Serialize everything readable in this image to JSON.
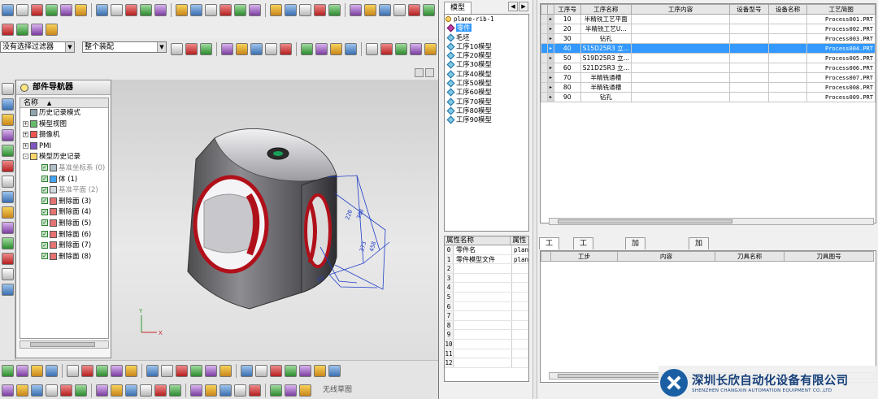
{
  "cad": {
    "filter_left": "没有选择过滤器",
    "filter_right": "整个装配",
    "nav_title": "部件导航器",
    "nav_header": "名称",
    "nav_nodes": [
      {
        "label": "历史记录模式",
        "icon": "history-icon",
        "expand": ""
      },
      {
        "label": "模型视图",
        "icon": "model-view-icon",
        "expand": "+"
      },
      {
        "label": "摄像机",
        "icon": "camera-icon",
        "expand": "+"
      },
      {
        "label": "PMI",
        "icon": "pmi-icon",
        "expand": "+"
      },
      {
        "label": "模型历史记录",
        "icon": "folder-icon",
        "expand": "-"
      },
      {
        "label": "基准坐标系 (0)",
        "icon": "datum-csys-icon",
        "expand": "",
        "dim": true
      },
      {
        "label": "体 (1)",
        "icon": "body-icon",
        "expand": ""
      },
      {
        "label": "基准平面 (2)",
        "icon": "datum-plane-icon",
        "expand": "",
        "dim": true
      },
      {
        "label": "删除面 (3)",
        "icon": "delete-face-icon",
        "expand": ""
      },
      {
        "label": "删除面 (4)",
        "icon": "delete-face-icon",
        "expand": ""
      },
      {
        "label": "删除面 (5)",
        "icon": "delete-face-icon",
        "expand": ""
      },
      {
        "label": "删除面 (6)",
        "icon": "delete-face-icon",
        "expand": ""
      },
      {
        "label": "删除面 (7)",
        "icon": "delete-face-icon",
        "expand": ""
      },
      {
        "label": "删除面 (8)",
        "icon": "delete-face-icon",
        "expand": ""
      }
    ],
    "dims": [
      "220",
      "308",
      "373",
      "458",
      "53"
    ],
    "axis_x": "X",
    "axis_y": "Y",
    "bottom_button": "无线草图"
  },
  "app": {
    "tab_model": "模型",
    "tree_root": "plane-rib-1",
    "tree_nodes": [
      {
        "label": "零件",
        "selected": true
      },
      {
        "label": "毛坯",
        "selected": false
      },
      {
        "label": "工序10模型",
        "selected": false
      },
      {
        "label": "工序20模型",
        "selected": false
      },
      {
        "label": "工序30模型",
        "selected": false
      },
      {
        "label": "工序40模型",
        "selected": false
      },
      {
        "label": "工序50模型",
        "selected": false
      },
      {
        "label": "工序60模型",
        "selected": false
      },
      {
        "label": "工序70模型",
        "selected": false
      },
      {
        "label": "工序80模型",
        "selected": false
      },
      {
        "label": "工序90模型",
        "selected": false
      }
    ],
    "props_headers": [
      "属性名称",
      "属性"
    ],
    "props_rows": [
      {
        "idx": "0",
        "name": "零件名",
        "val": "plan"
      },
      {
        "idx": "1",
        "name": "零件模型文件",
        "val": "plan"
      },
      {
        "idx": "2",
        "name": "",
        "val": ""
      },
      {
        "idx": "3",
        "name": "",
        "val": ""
      },
      {
        "idx": "4",
        "name": "",
        "val": ""
      },
      {
        "idx": "5",
        "name": "",
        "val": ""
      },
      {
        "idx": "6",
        "name": "",
        "val": ""
      },
      {
        "idx": "7",
        "name": "",
        "val": ""
      },
      {
        "idx": "8",
        "name": "",
        "val": ""
      },
      {
        "idx": "9",
        "name": "",
        "val": ""
      },
      {
        "idx": "10",
        "name": "",
        "val": ""
      },
      {
        "idx": "11",
        "name": "",
        "val": ""
      },
      {
        "idx": "12",
        "name": "",
        "val": ""
      }
    ],
    "grid_headers": [
      "工序号",
      "工序名称",
      "工序内容",
      "设备型号",
      "设备名称",
      "工艺简图"
    ],
    "grid_rows": [
      {
        "no": "10",
        "name": "半精铣工艺平面",
        "content": "",
        "model": "",
        "equip": "",
        "sketch": "Process001.PRT",
        "selected": false
      },
      {
        "no": "20",
        "name": "半精铣工艺U...",
        "content": "",
        "model": "",
        "equip": "",
        "sketch": "Process002.PRT",
        "selected": false
      },
      {
        "no": "30",
        "name": "钻孔",
        "content": "",
        "model": "",
        "equip": "",
        "sketch": "Process003.PRT",
        "selected": false
      },
      {
        "no": "40",
        "name": "S15D25R3 立...",
        "content": "",
        "model": "",
        "equip": "",
        "sketch": "Process004.PRT",
        "selected": true
      },
      {
        "no": "50",
        "name": "S19D25R3 立...",
        "content": "",
        "model": "",
        "equip": "",
        "sketch": "Process005.PRT",
        "selected": false
      },
      {
        "no": "60",
        "name": "S21D25R3 立...",
        "content": "",
        "model": "",
        "equip": "",
        "sketch": "Process006.PRT",
        "selected": false
      },
      {
        "no": "70",
        "name": "半精铣通槽",
        "content": "",
        "model": "",
        "equip": "",
        "sketch": "Process007.PRT",
        "selected": false
      },
      {
        "no": "80",
        "name": "半精铣通槽",
        "content": "",
        "model": "",
        "equip": "",
        "sketch": "Process008.PRT",
        "selected": false
      },
      {
        "no": "90",
        "name": "钻孔",
        "content": "",
        "model": "",
        "equip": "",
        "sketch": "Process009.PRT",
        "selected": false
      }
    ],
    "step_tabs": [
      "工步",
      "工序属性",
      "加工步骤尺寸",
      "加工步骤扩展属性"
    ],
    "step_headers": [
      "工步",
      "内容",
      "刀具名称",
      "刀具图号"
    ],
    "logo_cn": "深圳长欣自动化设备有限公司",
    "logo_en": "SHENZHEN CHANGXIN AUTOMATION EQUIPMENT CO.,LTD"
  }
}
